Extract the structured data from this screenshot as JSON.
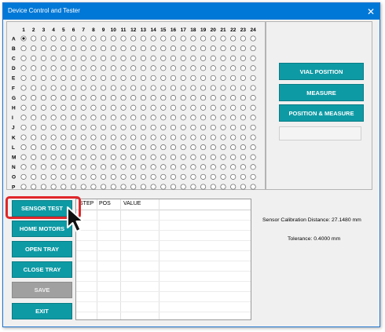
{
  "window": {
    "title": "Device Control and Tester",
    "close_glyph": "✕"
  },
  "grid": {
    "columns": [
      "1",
      "2",
      "3",
      "4",
      "5",
      "6",
      "7",
      "8",
      "9",
      "10",
      "11",
      "12",
      "13",
      "14",
      "15",
      "16",
      "17",
      "18",
      "19",
      "20",
      "21",
      "22",
      "23",
      "24"
    ],
    "rows": [
      "A",
      "B",
      "C",
      "D",
      "E",
      "F",
      "G",
      "H",
      "I",
      "J",
      "K",
      "L",
      "M",
      "N",
      "O",
      "P"
    ],
    "selected": {
      "row": "A",
      "column": "1"
    }
  },
  "right_panel": {
    "vial_position": "VIAL POSITION",
    "measure": "MEASURE",
    "position_measure": "POSITION & MEASURE",
    "readout_value": ""
  },
  "left_buttons": {
    "sensor_test": "SENSOR TEST",
    "home_motors": "HOME MOTORS",
    "open_tray": "OPEN TRAY",
    "close_tray": "CLOSE TRAY",
    "save": "SAVE",
    "exit": "EXIT"
  },
  "table": {
    "headers": [
      "STEP",
      "POS",
      "VALUE"
    ],
    "rows": []
  },
  "info": {
    "calibration": "Sensor Calibration Distance: 27.1480 mm",
    "tolerance": "Tolerance: 0.4000 mm"
  },
  "colors": {
    "title_bar": "#0078d7",
    "button": "#0e9aa5",
    "button_disabled": "#a0a0a0",
    "highlight": "#e0262a"
  }
}
